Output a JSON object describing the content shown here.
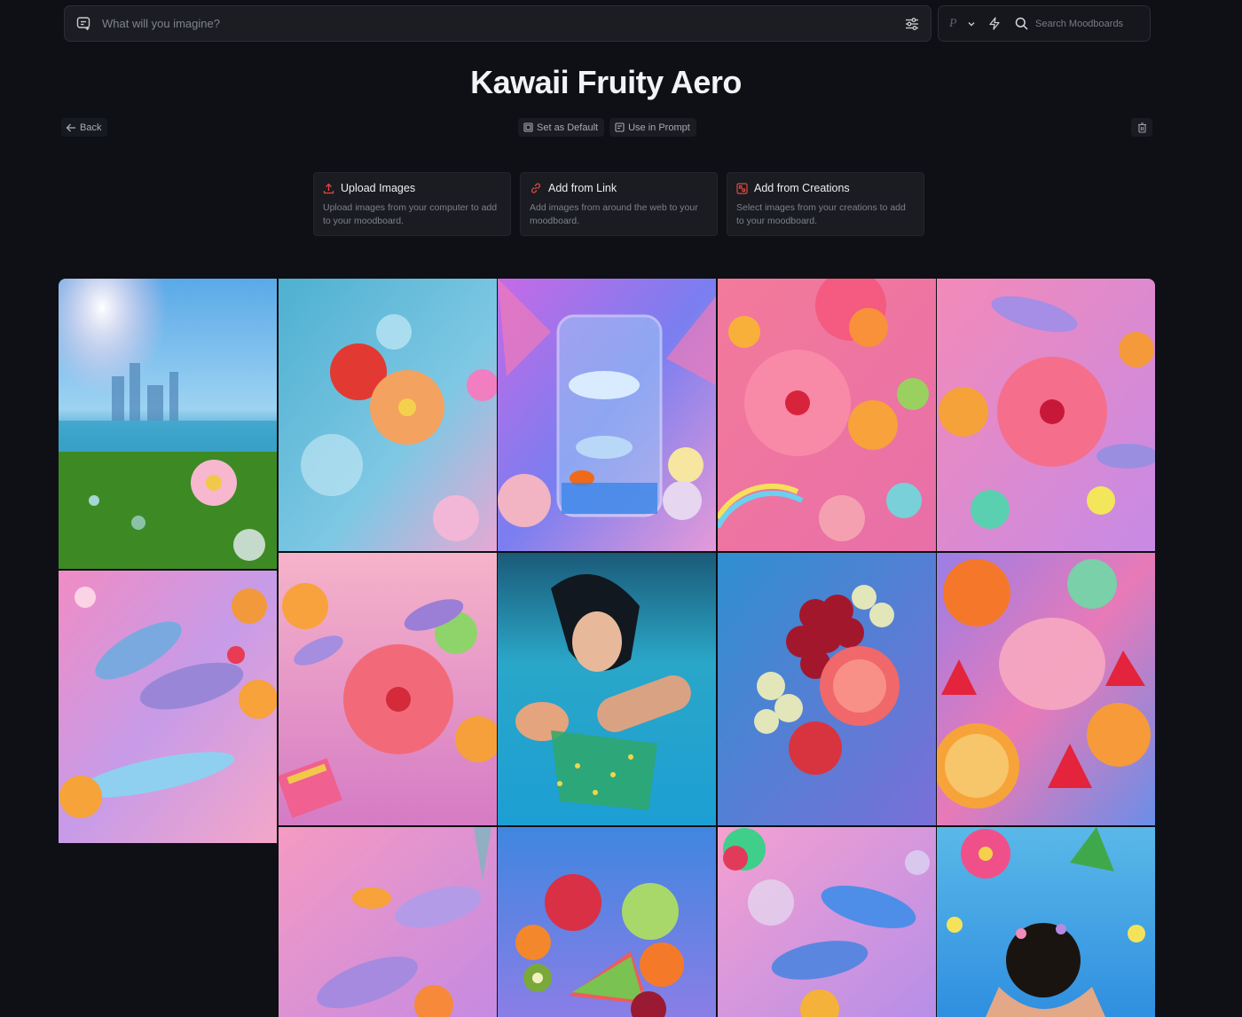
{
  "prompt": {
    "placeholder": "What will you imagine?"
  },
  "search": {
    "placeholder": "Search Moodboards",
    "profile_mark": "P"
  },
  "title": "Kawaii Fruity Aero",
  "toolbar": {
    "back_label": "Back",
    "set_default_label": "Set as Default",
    "use_in_prompt_label": "Use in Prompt"
  },
  "add_cards": [
    {
      "title": "Upload Images",
      "description": "Upload images from your computer to add to your moodboard."
    },
    {
      "title": "Add from Link",
      "description": "Add images from around the web to your moodboard."
    },
    {
      "title": "Add from Creations",
      "description": "Select images from your creations to add to your moodboard."
    }
  ],
  "colors": {
    "background": "#0e1015",
    "card": "#1a1c22",
    "accent_red": "#e0483f"
  },
  "icons": [
    "prompt-icon",
    "sliders-icon",
    "chevron-down-icon",
    "bolt-icon",
    "search-icon",
    "arrow-left-icon",
    "set-default-icon",
    "use-in-prompt-icon",
    "trash-icon",
    "upload-icon",
    "link-icon",
    "creations-icon"
  ]
}
